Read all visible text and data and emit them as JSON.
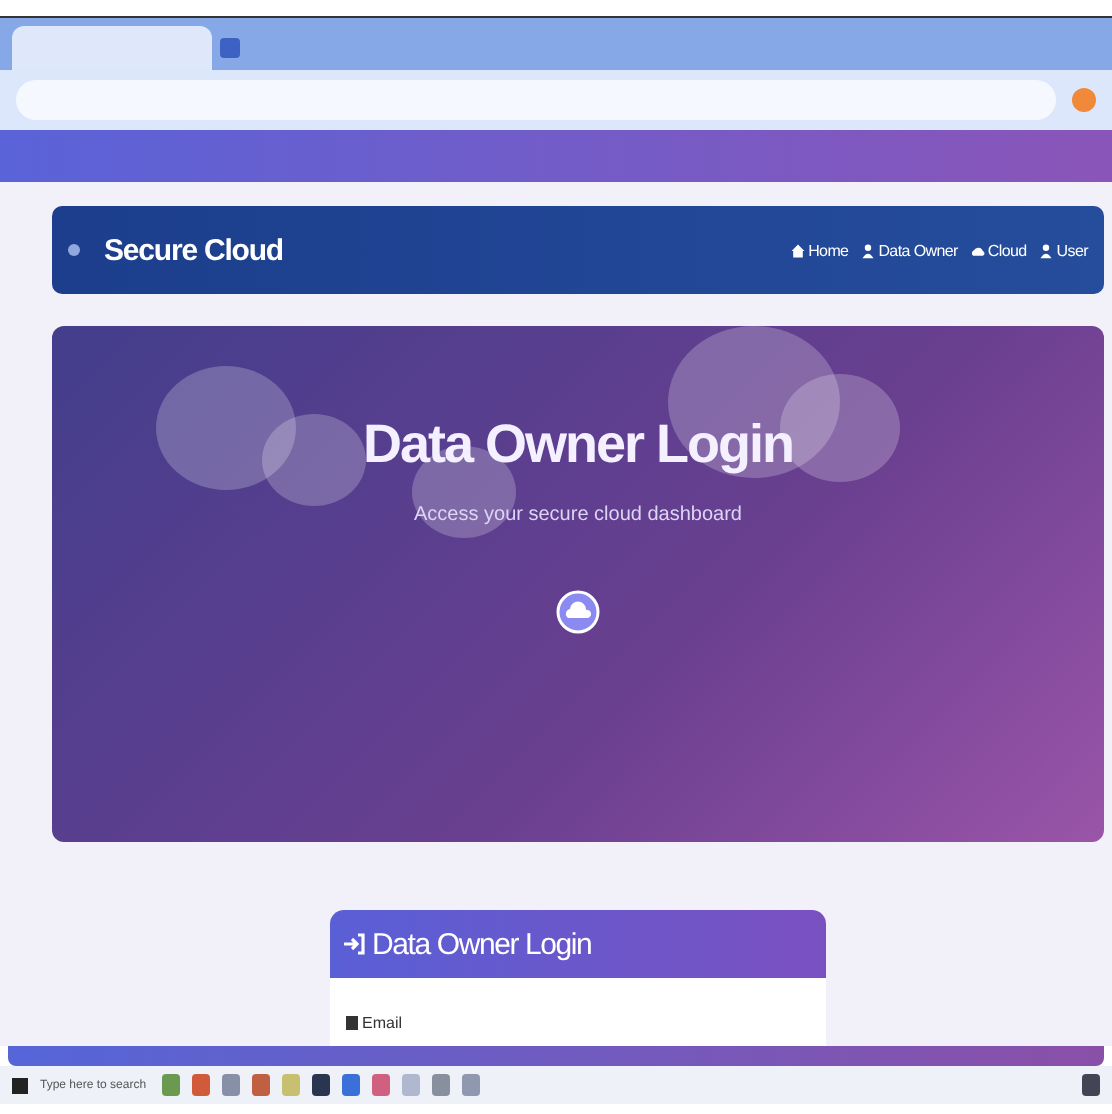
{
  "navbar": {
    "brand": "Secure Cloud",
    "links": [
      {
        "label": "Home",
        "kind": "home"
      },
      {
        "label": "Data Owner",
        "kind": "user"
      },
      {
        "label": "Cloud",
        "kind": "cloud"
      },
      {
        "label": "User",
        "kind": "user"
      }
    ]
  },
  "hero": {
    "title": "Data Owner Login",
    "subtitle": "Access your secure cloud dashboard"
  },
  "login_card": {
    "title": "Data Owner Login",
    "field_label": "Email"
  },
  "taskbar": {
    "search_placeholder": "Type here to search"
  }
}
